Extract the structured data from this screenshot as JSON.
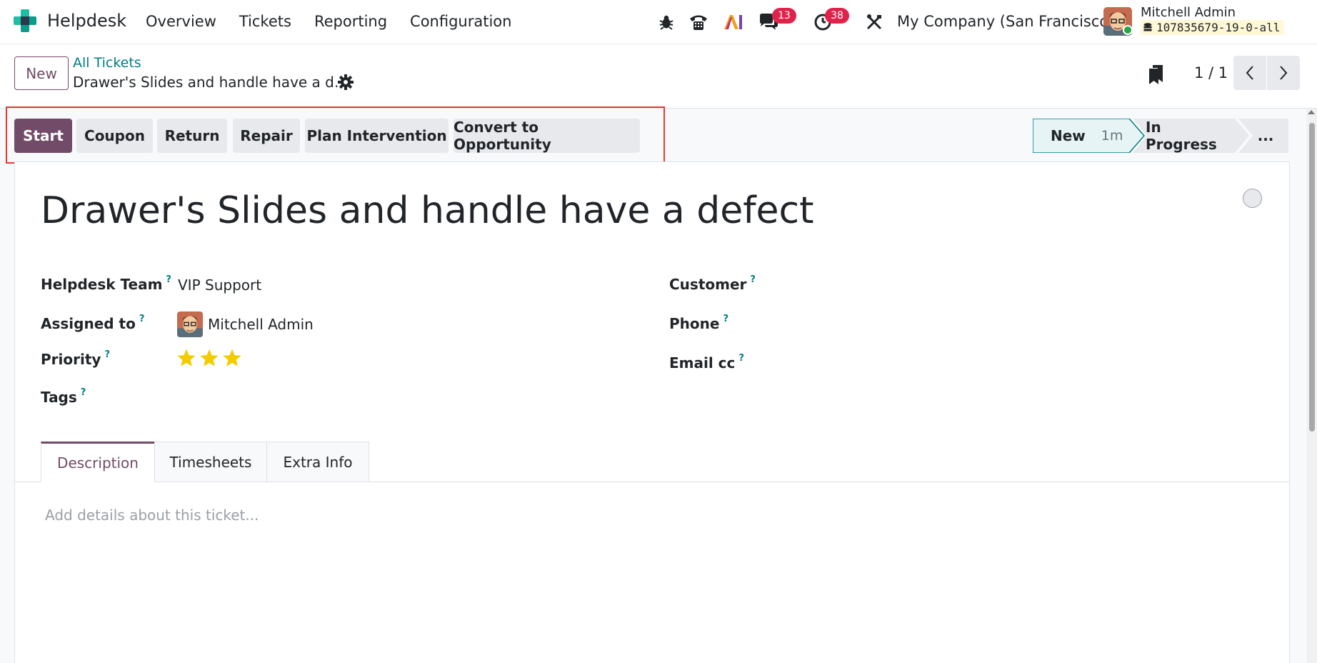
{
  "navbar": {
    "app_name": "Helpdesk",
    "menu": [
      "Overview",
      "Tickets",
      "Reporting",
      "Configuration"
    ],
    "chat_badge": "13",
    "activity_badge": "38",
    "company": "My Company (San Francisco)",
    "user_name": "Mitchell Admin",
    "db_name": "107835679-19-0-all"
  },
  "control_panel": {
    "new_label": "New",
    "breadcrumb_parent": "All Tickets",
    "breadcrumb_current": "Drawer's Slides and handle have a d…",
    "pager": "1 / 1"
  },
  "actions": {
    "start": "Start",
    "coupon": "Coupon",
    "return": "Return",
    "repair": "Repair",
    "plan_intervention": "Plan Intervention",
    "convert": "Convert to Opportunity"
  },
  "stages": {
    "new": "New",
    "new_duration": "1m",
    "in_progress": "In Progress",
    "more": "..."
  },
  "ticket": {
    "title": "Drawer's Slides and handle have a defect",
    "help_mark": "?",
    "helpdesk_team_label": "Helpdesk Team",
    "helpdesk_team": "VIP Support",
    "assigned_to_label": "Assigned to",
    "assigned_to": "Mitchell Admin",
    "priority_label": "Priority",
    "priority_stars": 3,
    "tags_label": "Tags",
    "customer_label": "Customer",
    "phone_label": "Phone",
    "email_cc_label": "Email cc"
  },
  "tabs": [
    "Description",
    "Timesheets",
    "Extra Info"
  ],
  "description_placeholder": "Add details about this ticket...",
  "colors": {
    "brand": "#714b67",
    "link": "#017e84",
    "badge": "#e0234b",
    "star": "#f3cc00",
    "highlight": "#e53935"
  }
}
